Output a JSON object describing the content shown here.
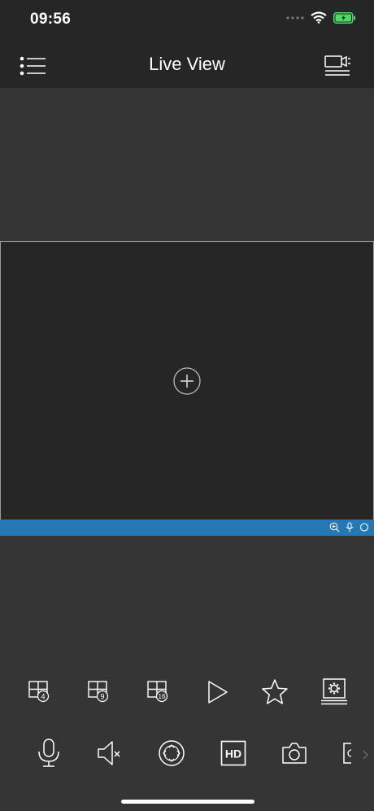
{
  "status_bar": {
    "time": "09:56"
  },
  "header": {
    "title": "Live View"
  },
  "layout_buttons": [
    {
      "id": "split-4",
      "badge": "4"
    },
    {
      "id": "split-9",
      "badge": "9"
    },
    {
      "id": "split-16",
      "badge": "16"
    }
  ],
  "toolbar": {
    "hd_label": "HD"
  },
  "colors": {
    "accent": "#2479b5",
    "background": "#353535",
    "topbar": "#262626",
    "battery": "#4cd964"
  }
}
